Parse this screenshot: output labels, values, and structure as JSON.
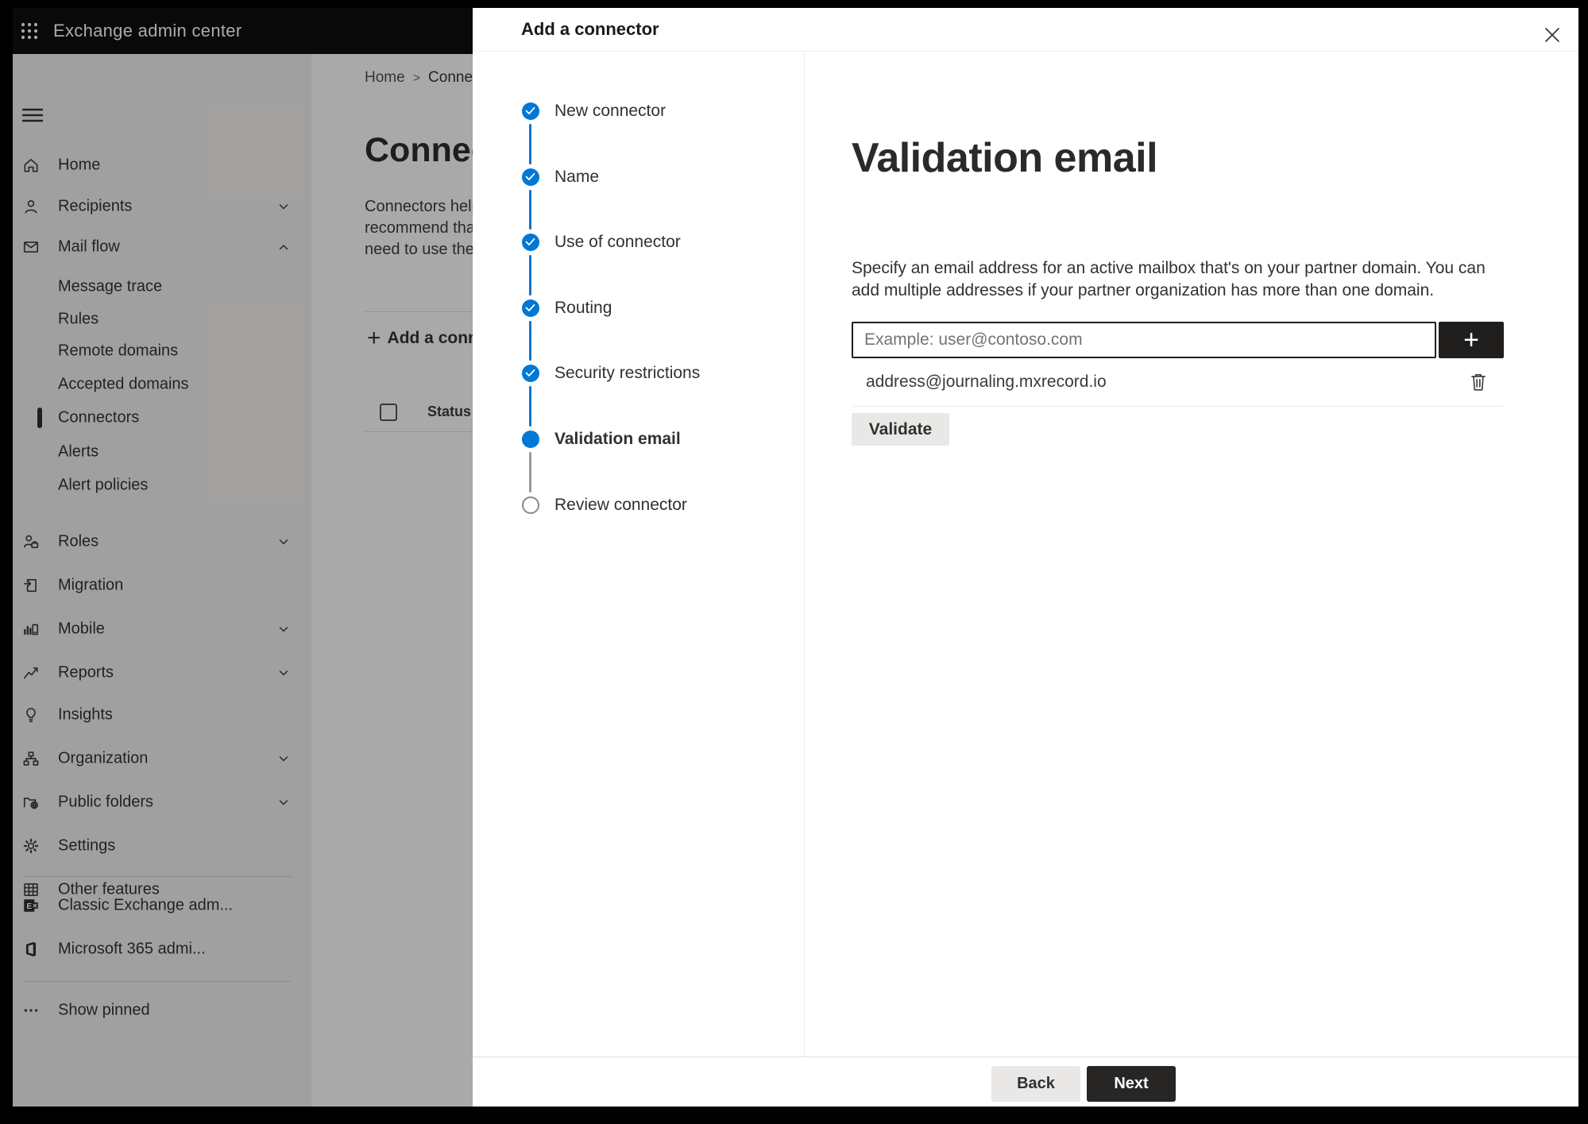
{
  "topbar": {
    "app_title": "Exchange admin center"
  },
  "sidebar": {
    "top_items": [
      {
        "label": "Home"
      },
      {
        "label": "Recipients",
        "chevron": "down"
      },
      {
        "label": "Mail flow",
        "chevron": "up"
      }
    ],
    "mailflow_children": [
      {
        "label": "Message trace"
      },
      {
        "label": "Rules"
      },
      {
        "label": "Remote domains"
      },
      {
        "label": "Accepted domains"
      },
      {
        "label": "Connectors",
        "selected": true
      },
      {
        "label": "Alerts"
      },
      {
        "label": "Alert policies"
      }
    ],
    "lower_items": [
      {
        "label": "Roles",
        "chevron": "down"
      },
      {
        "label": "Migration"
      },
      {
        "label": "Mobile",
        "chevron": "down"
      },
      {
        "label": "Reports",
        "chevron": "down"
      },
      {
        "label": "Insights"
      },
      {
        "label": "Organization",
        "chevron": "down"
      },
      {
        "label": "Public folders",
        "chevron": "down"
      },
      {
        "label": "Settings"
      },
      {
        "label": "Other features"
      }
    ],
    "footer_items": [
      {
        "label": "Classic Exchange adm..."
      },
      {
        "label": "Microsoft 365 admi..."
      }
    ],
    "show_pinned_label": "Show pinned"
  },
  "page": {
    "breadcrumb_home": "Home",
    "breadcrumb_separator": ">",
    "breadcrumb_current": "Conne",
    "title": "Connec",
    "intro_lines": [
      "Connectors help",
      "recommend tha",
      "need to use ther"
    ],
    "add_connector_label": "Add a conn",
    "status_header": "Status"
  },
  "modal": {
    "title": "Add a connector",
    "steps": [
      {
        "label": "New connector",
        "state": "done"
      },
      {
        "label": "Name",
        "state": "done"
      },
      {
        "label": "Use of connector",
        "state": "done"
      },
      {
        "label": "Routing",
        "state": "done"
      },
      {
        "label": "Security restrictions",
        "state": "done"
      },
      {
        "label": "Validation email",
        "state": "current"
      },
      {
        "label": "Review connector",
        "state": "todo"
      }
    ],
    "content": {
      "heading": "Validation email",
      "description": "Specify an email address for an active mailbox that's on your partner domain. You can add multiple addresses if your partner organization has more than one domain.",
      "email_placeholder": "Example: user@contoso.com",
      "email_value": "",
      "add_address_label": "+",
      "addresses": [
        "address@journaling.mxrecord.io"
      ],
      "validate_label": "Validate"
    },
    "footer": {
      "back_label": "Back",
      "next_label": "Next"
    }
  },
  "colors": {
    "accent": "#0078d4",
    "dark_button": "#272625",
    "step_pending": "#8a8886",
    "sidebar_bg": "#f3f2f1"
  }
}
